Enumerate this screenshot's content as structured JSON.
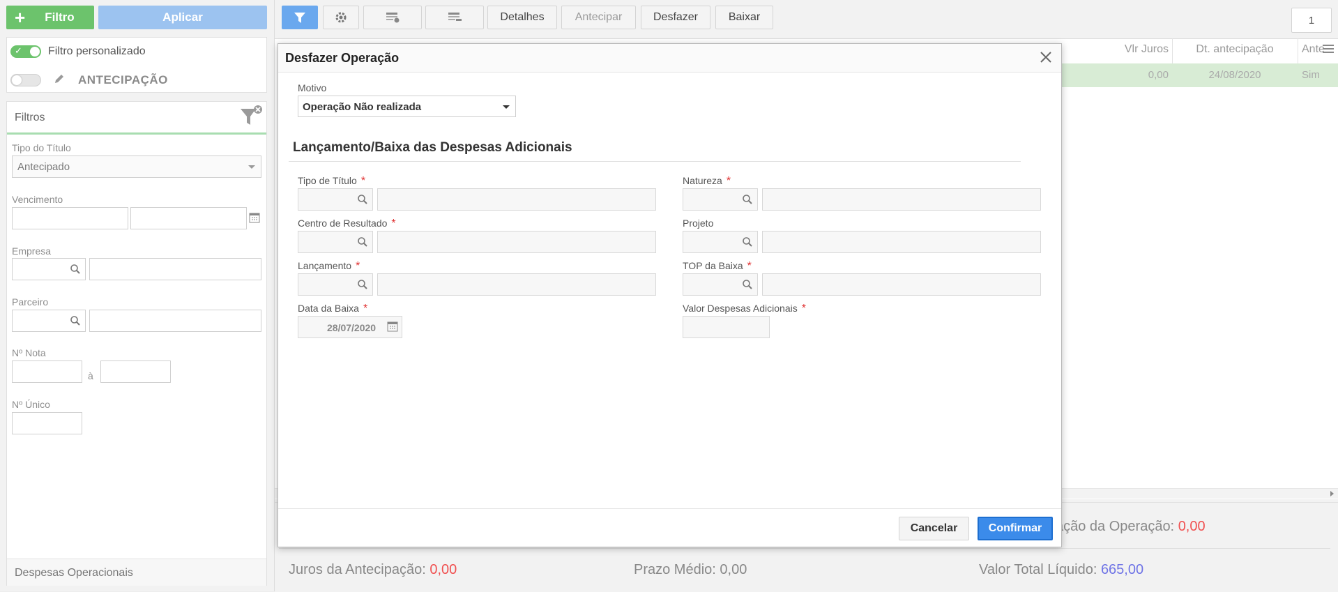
{
  "sidebar": {
    "add_filter_label": "Filtro",
    "apply_label": "Aplicar",
    "custom_filter_label": "Filtro personalizado",
    "antecipacao_label": "ANTECIPAÇÃO",
    "filters_title": "Filtros",
    "tipo_titulo_label": "Tipo do Título",
    "tipo_titulo_value": "Antecipado",
    "vencimento_label": "Vencimento",
    "empresa_label": "Empresa",
    "parceiro_label": "Parceiro",
    "nota_label": "Nº Nota",
    "nota_sep": "à",
    "unico_label": "Nº Único",
    "despesas_label": "Despesas Operacionais"
  },
  "toolbar": {
    "detalhes": "Detalhes",
    "antecipar": "Antecipar",
    "desfazer": "Desfazer",
    "baixar": "Baixar",
    "page_number": "1"
  },
  "grid": {
    "headers": [
      "Vlr Juros",
      "Dt. antecipação",
      "Ante"
    ],
    "row": [
      "0,00",
      "24/08/2020",
      "Sim"
    ]
  },
  "summary": {
    "operacao_label": "ação da Operação:",
    "operacao_value": "0,00",
    "juros_label": "Juros da Antecipação:",
    "juros_value": "0,00",
    "prazo_label": "Prazo Médio:",
    "prazo_value": "0,00",
    "total_label": "Valor Total Líquido:",
    "total_value": "665,00"
  },
  "modal": {
    "title": "Desfazer Operação",
    "motivo_label": "Motivo",
    "motivo_value": "Operação Não realizada",
    "section_title": "Lançamento/Baixa das Despesas Adicionais",
    "tipo_titulo_label": "Tipo de Título",
    "natureza_label": "Natureza",
    "centro_label": "Centro de Resultado",
    "projeto_label": "Projeto",
    "lancamento_label": "Lançamento",
    "top_baixa_label": "TOP da Baixa",
    "data_baixa_label": "Data da Baixa",
    "data_baixa_value": "28/07/2020",
    "valor_despesas_label": "Valor Despesas Adicionais",
    "required_mark": "*",
    "cancel_label": "Cancelar",
    "confirm_label": "Confirmar"
  },
  "colors": {
    "green": "#6cc36c",
    "blue_light": "#9cc3f0",
    "blue": "#3b8bea",
    "red_value": "#f05050",
    "blue_value": "#6f74e6"
  }
}
